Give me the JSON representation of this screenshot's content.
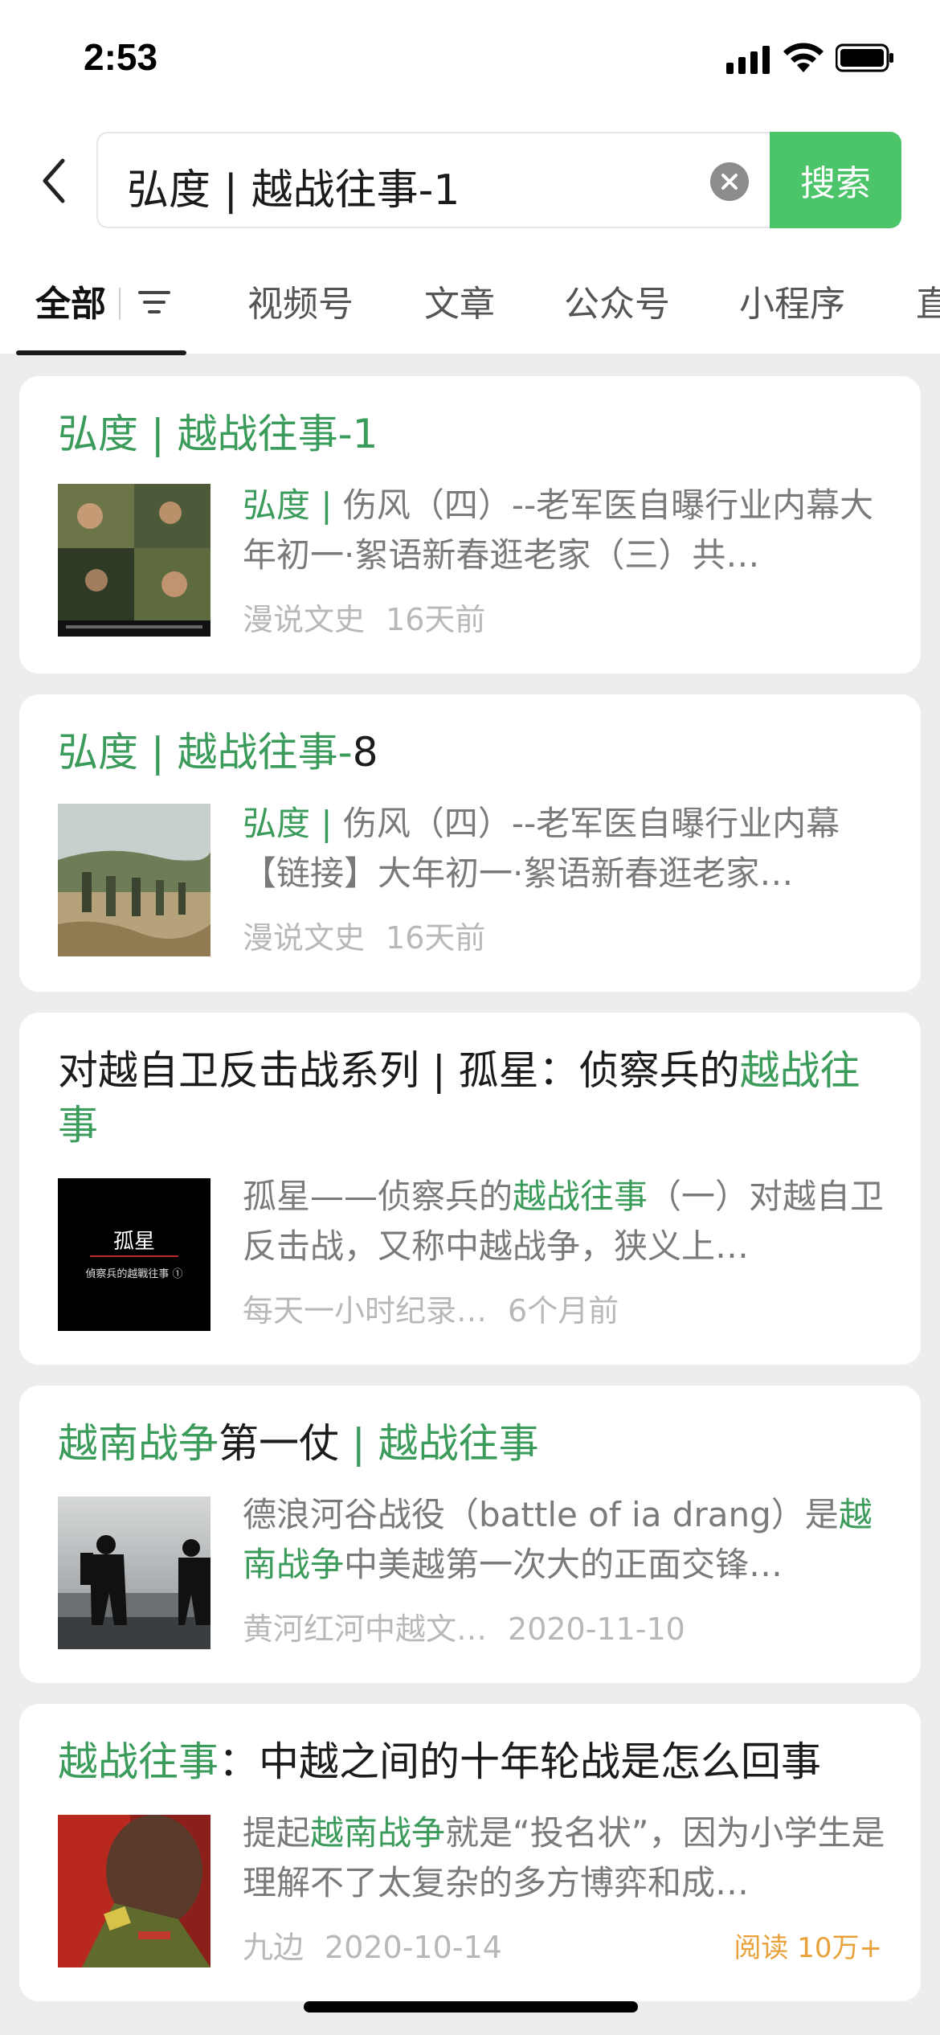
{
  "status_bar": {
    "time": "2:53"
  },
  "search": {
    "query": "弘度 | 越战往事-1",
    "button_label": "搜索"
  },
  "tabs": [
    {
      "label": "全部"
    },
    {
      "label": "视频号"
    },
    {
      "label": "文章"
    },
    {
      "label": "公众号"
    },
    {
      "label": "小程序"
    },
    {
      "label": "直"
    }
  ],
  "results": [
    {
      "title": [
        {
          "t": "弘度 | 越战往事-1",
          "hl": true
        }
      ],
      "snippet": [
        {
          "t": "弘度 | ",
          "hl": true
        },
        {
          "t": "伤风（四）--老军医自曝行业内幕大年初一·絮语新春逛老家（三）共…",
          "hl": false
        }
      ],
      "source": "漫说文史",
      "time": "16天前",
      "thumb": "soldiers-collage-thumbnail"
    },
    {
      "title": [
        {
          "t": "弘度 | 越战往事-",
          "hl": true
        },
        {
          "t": "8",
          "hl": false
        }
      ],
      "snippet": [
        {
          "t": "弘度 | ",
          "hl": true
        },
        {
          "t": "伤风（四）--老军医自曝行业内幕【链接】大年初一·絮语新春逛老家…",
          "hl": false
        }
      ],
      "source": "漫说文史",
      "time": "16天前",
      "thumb": "soldiers-marching-thumbnail"
    },
    {
      "title": [
        {
          "t": "对越自卫反击战系列 | 孤星：侦察兵的",
          "hl": false
        },
        {
          "t": "越战往事",
          "hl": true
        }
      ],
      "snippet": [
        {
          "t": "孤星——侦察兵的",
          "hl": false
        },
        {
          "t": "越战往事",
          "hl": true
        },
        {
          "t": "（一）对越自卫反击战，又称中越战争，狭义上…",
          "hl": false
        }
      ],
      "source": "每天一小时纪录…",
      "time": "6个月前",
      "thumb": "lone-star-title-thumbnail",
      "thumb_text": {
        "title": "孤星",
        "subtitle": "偵察兵的越戰往事 ①"
      }
    },
    {
      "title": [
        {
          "t": "越南战争",
          "hl": true
        },
        {
          "t": "第一仗",
          "hl": false
        },
        {
          "t": " | 越战往事",
          "hl": true
        }
      ],
      "snippet": [
        {
          "t": "德浪河谷战役（battle of ia drang）是",
          "hl": false
        },
        {
          "t": "越南战争",
          "hl": true
        },
        {
          "t": "中美越第一次大的正面交锋…",
          "hl": false
        }
      ],
      "source": "黄河红河中越文…",
      "time": "2020-11-10",
      "thumb": "soldier-silhouettes-thumbnail"
    },
    {
      "title": [
        {
          "t": "越战往事",
          "hl": true
        },
        {
          "t": "：中越之间的十年轮战是怎么回事",
          "hl": false
        }
      ],
      "snippet": [
        {
          "t": "提起",
          "hl": false
        },
        {
          "t": "越南战争",
          "hl": true
        },
        {
          "t": "就是“投名状”，因为小学生是理解不了太复杂的多方博弈和成…",
          "hl": false
        }
      ],
      "source": "九边",
      "time": "2020-10-14",
      "reads": "阅读 10万+",
      "thumb": "soldier-closeup-thumbnail"
    }
  ]
}
